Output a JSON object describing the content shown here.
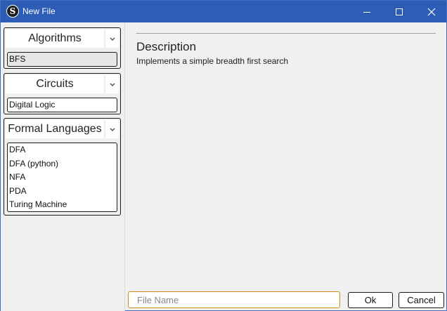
{
  "window": {
    "title": "New File",
    "app_icon_letter": "S",
    "controls": [
      "minimize-icon",
      "maximize-icon",
      "close-icon"
    ]
  },
  "categories": [
    {
      "title": "Algorithms",
      "items": [
        "BFS"
      ],
      "selected": "BFS"
    },
    {
      "title": "Circuits",
      "items": [
        "Digital Logic"
      ]
    },
    {
      "title": "Formal Languages",
      "items": [
        "DFA",
        "DFA (python)",
        "NFA",
        "PDA",
        "Turing Machine"
      ]
    }
  ],
  "description": {
    "heading": "Description",
    "text": "Implements a simple breadth first search"
  },
  "footer": {
    "filename_placeholder": "File Name",
    "filename_value": "",
    "ok_label": "Ok",
    "cancel_label": "Cancel"
  },
  "colors": {
    "titlebar": "#2d5db5",
    "input_focus_border": "#d08a1c"
  }
}
